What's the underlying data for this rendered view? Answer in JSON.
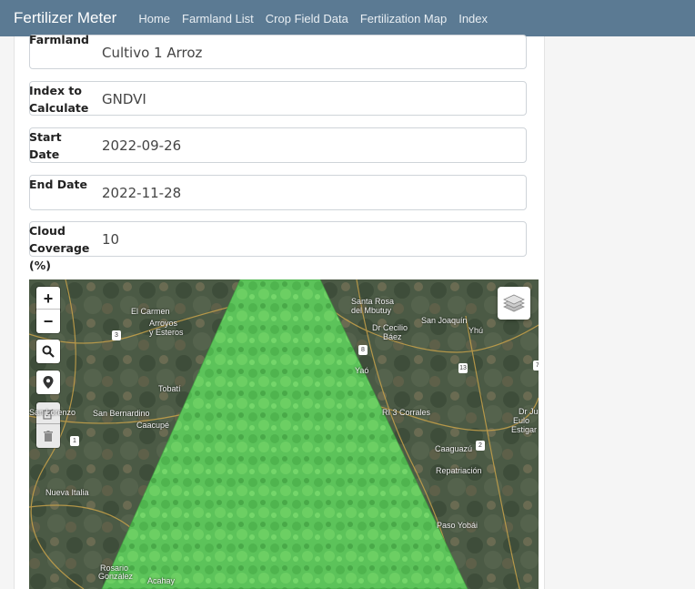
{
  "nav": {
    "brand": "Fertilizer Meter",
    "links": [
      "Home",
      "Farmland List",
      "Crop Field Data",
      "Fertilization Map",
      "Index"
    ]
  },
  "form": {
    "farmland": {
      "label": "Farmland",
      "value": "Cultivo 1 Arroz"
    },
    "index": {
      "label": "Index to Calculate",
      "value": "GNDVI"
    },
    "start_date": {
      "label": "Start Date",
      "value": "2022-09-26"
    },
    "end_date": {
      "label": "End Date",
      "value": "2022-11-28"
    },
    "cloud": {
      "label": "Cloud Coverage (%)",
      "value": "10"
    }
  },
  "map": {
    "controls": {
      "zoom_in": "+",
      "zoom_out": "−"
    },
    "places": [
      {
        "text": "Santa Rosa"
      },
      {
        "text": "del Mbutuy"
      },
      {
        "text": "San Joaquín"
      },
      {
        "text": "Yhú"
      },
      {
        "text": "El Carmen"
      },
      {
        "text": "Arroyos"
      },
      {
        "text": "y Esteros"
      },
      {
        "text": "Dr Cecilio"
      },
      {
        "text": "Báez"
      },
      {
        "text": "Yaó"
      },
      {
        "text": "Tobatí"
      },
      {
        "text": "San Lorenzo"
      },
      {
        "text": "San Bernardino"
      },
      {
        "text": "Caacupé"
      },
      {
        "text": "RI 3 Corrales"
      },
      {
        "text": "Caaguazú"
      },
      {
        "text": "Repatriación"
      },
      {
        "text": "Nueva Italia"
      },
      {
        "text": "Paso Yobái"
      },
      {
        "text": "Rosario"
      },
      {
        "text": "González"
      },
      {
        "text": "Acahay"
      },
      {
        "text": "Dr Ju"
      },
      {
        "text": "Eulo"
      },
      {
        "text": "Estigar"
      }
    ],
    "route_shields": [
      "3",
      "8",
      "13",
      "1",
      "2",
      "7"
    ],
    "overlay_color": "#5cc35a"
  }
}
